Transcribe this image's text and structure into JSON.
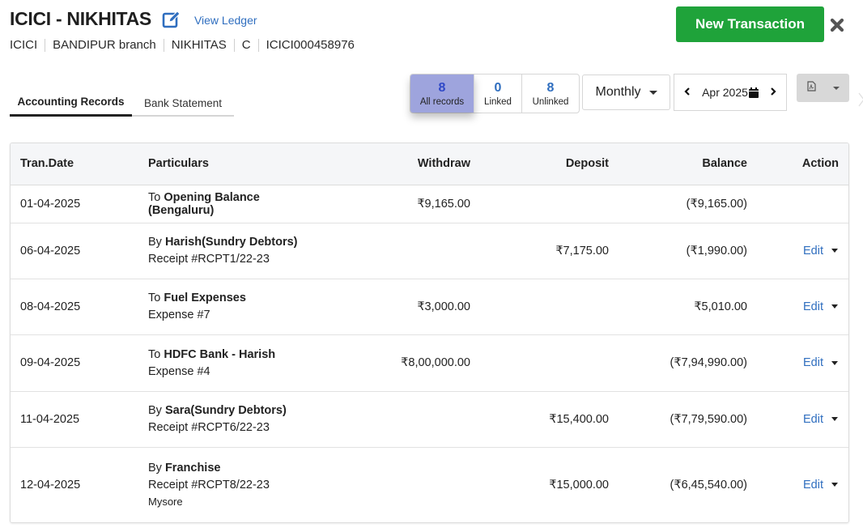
{
  "header": {
    "title": "ICICI - NIKHITAS",
    "view_ledger": "View Ledger",
    "meta": [
      "ICICI",
      "BANDIPUR branch",
      "NIKHITAS",
      "C",
      "ICICI000458976"
    ],
    "new_transaction": "New Transaction"
  },
  "tabs": [
    {
      "label": "Accounting Records",
      "active": true
    },
    {
      "label": "Bank Statement",
      "active": false
    }
  ],
  "counts": [
    {
      "value": "8",
      "label": "All records",
      "active": true
    },
    {
      "value": "0",
      "label": "Linked",
      "active": false
    },
    {
      "value": "8",
      "label": "Unlinked",
      "active": false
    }
  ],
  "period": {
    "selected": "Monthly"
  },
  "month_nav": {
    "label": "Apr 2025"
  },
  "table": {
    "headers": {
      "date": "Tran.Date",
      "particulars": "Particulars",
      "withdraw": "Withdraw",
      "deposit": "Deposit",
      "balance": "Balance",
      "action": "Action"
    },
    "rows": [
      {
        "date": "01-04-2025",
        "prefix": "To",
        "name": "Opening Balance (Bengaluru)",
        "ref": "",
        "note": "",
        "withdraw": "₹9,165.00",
        "deposit": "",
        "balance": "(₹9,165.00)",
        "action": ""
      },
      {
        "date": "06-04-2025",
        "prefix": "By",
        "name": "Harish(Sundry Debtors)",
        "ref": "Receipt #RCPT1/22-23",
        "note": "",
        "withdraw": "",
        "deposit": "₹7,175.00",
        "balance": "(₹1,990.00)",
        "action": "Edit"
      },
      {
        "date": "08-04-2025",
        "prefix": "To",
        "name": "Fuel Expenses",
        "ref": "Expense #7",
        "note": "",
        "withdraw": "₹3,000.00",
        "deposit": "",
        "balance": "₹5,010.00",
        "action": "Edit"
      },
      {
        "date": "09-04-2025",
        "prefix": "To",
        "name": "HDFC Bank - Harish",
        "ref": "Expense #4",
        "note": "",
        "withdraw": "₹8,00,000.00",
        "deposit": "",
        "balance": "(₹7,94,990.00)",
        "action": "Edit"
      },
      {
        "date": "11-04-2025",
        "prefix": "By",
        "name": "Sara(Sundry Debtors)",
        "ref": "Receipt #RCPT6/22-23",
        "note": "",
        "withdraw": "",
        "deposit": "₹15,400.00",
        "balance": "(₹7,79,590.00)",
        "action": "Edit"
      },
      {
        "date": "12-04-2025",
        "prefix": "By",
        "name": "Franchise",
        "ref": "Receipt #RCPT8/22-23",
        "note": "Mysore",
        "withdraw": "",
        "deposit": "₹15,000.00",
        "balance": "(₹6,45,540.00)",
        "action": "Edit"
      }
    ]
  },
  "colors": {
    "accent_blue": "#2f6ebf",
    "new_button_green": "#1fa33a",
    "active_count_bg": "#9ea4dd"
  }
}
